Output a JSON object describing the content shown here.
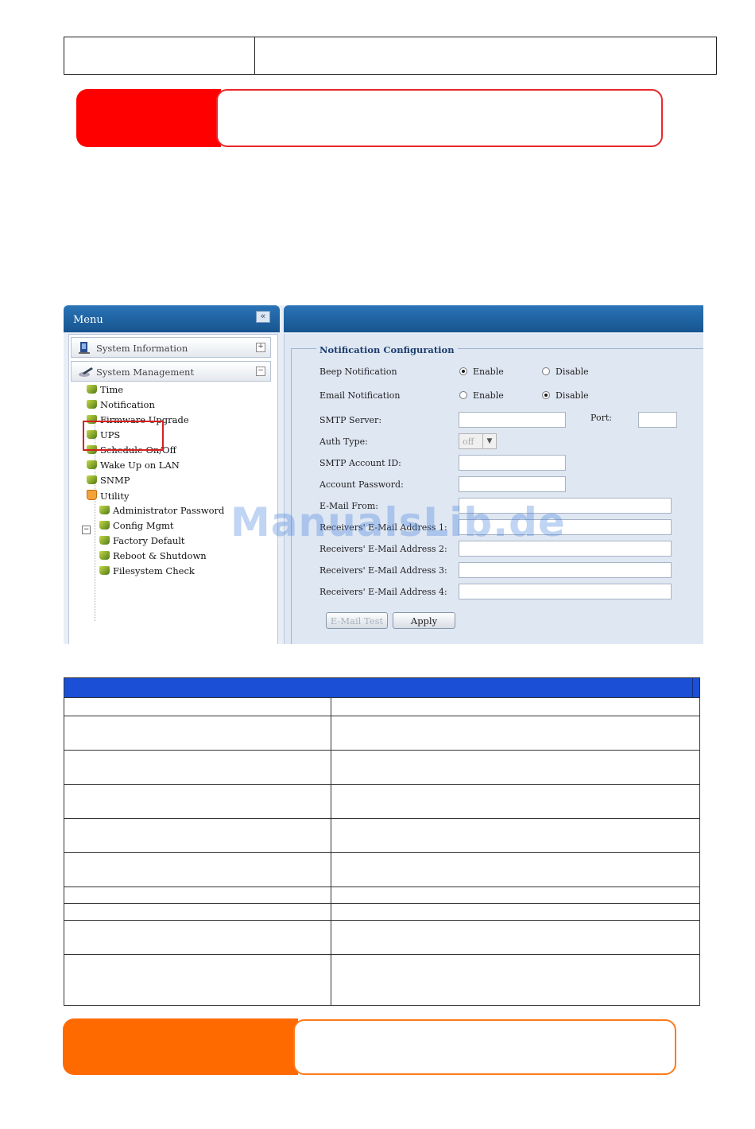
{
  "menu": {
    "title": "Menu",
    "collapse_glyph": "«",
    "sections": [
      {
        "label": "System Information",
        "toggle": "+"
      },
      {
        "label": "System Management",
        "toggle": "−"
      }
    ],
    "items": [
      "Time",
      "Notification",
      "Firmware Upgrade",
      "UPS",
      "Schedule On/Off",
      "Wake Up on LAN",
      "SNMP"
    ],
    "utility": {
      "label": "Utility",
      "items": [
        "Administrator Password",
        "Config Mgmt",
        "Factory Default",
        "Reboot & Shutdown",
        "Filesystem Check"
      ]
    }
  },
  "form": {
    "legend": "Notification Configuration",
    "beep_label": "Beep Notification",
    "email_label": "Email Notification",
    "enable": "Enable",
    "disable": "Disable",
    "smtp_server_label": "SMTP Server:",
    "port_label": "Port:",
    "auth_type_label": "Auth Type:",
    "auth_type_value": "off",
    "smtp_account_label": "SMTP Account ID:",
    "account_password_label": "Account Password:",
    "email_from_label": "E-Mail From:",
    "receiver1_label": "Receivers' E-Mail Address 1:",
    "receiver2_label": "Receivers' E-Mail Address 2:",
    "receiver3_label": "Receivers' E-Mail Address 3:",
    "receiver4_label": "Receivers' E-Mail Address 4:",
    "email_test_button": "E-Mail Test",
    "apply_button": "Apply"
  },
  "watermark": "ManualsLib.de"
}
